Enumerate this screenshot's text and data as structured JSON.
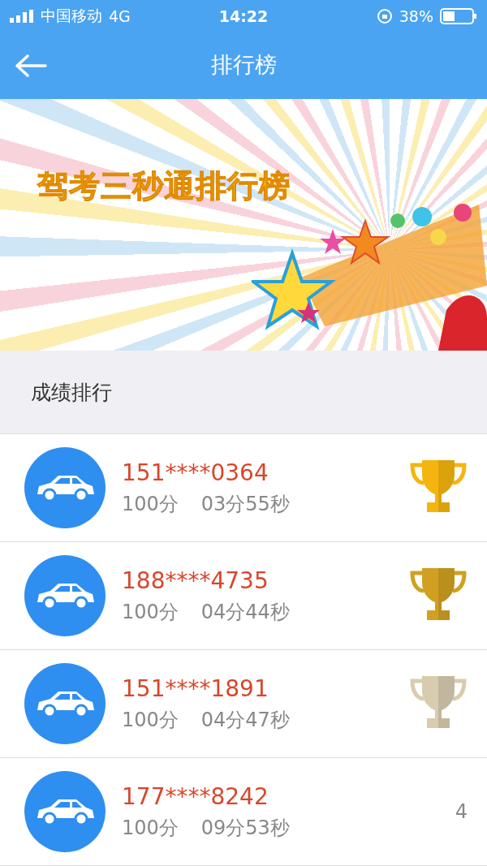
{
  "status_bar": {
    "carrier": "中国移动",
    "network": "4G",
    "time": "14:22",
    "battery": "38%"
  },
  "nav": {
    "title": "排行榜"
  },
  "banner": {
    "title": "驾考三秒通排行榜"
  },
  "section": {
    "title": "成绩排行"
  },
  "rows": [
    {
      "phone": "151****0364",
      "score": "100分",
      "time": "03分55秒",
      "kind": "trophy",
      "color": "#f5b50e"
    },
    {
      "phone": "188****4735",
      "score": "100分",
      "time": "04分44秒",
      "kind": "trophy",
      "color": "#d1a021"
    },
    {
      "phone": "151****1891",
      "score": "100分",
      "time": "04分47秒",
      "kind": "trophy",
      "color": "#d8cbb0"
    },
    {
      "phone": "177****8242",
      "score": "100分",
      "time": "09分53秒",
      "kind": "rank",
      "rank": "4"
    }
  ]
}
